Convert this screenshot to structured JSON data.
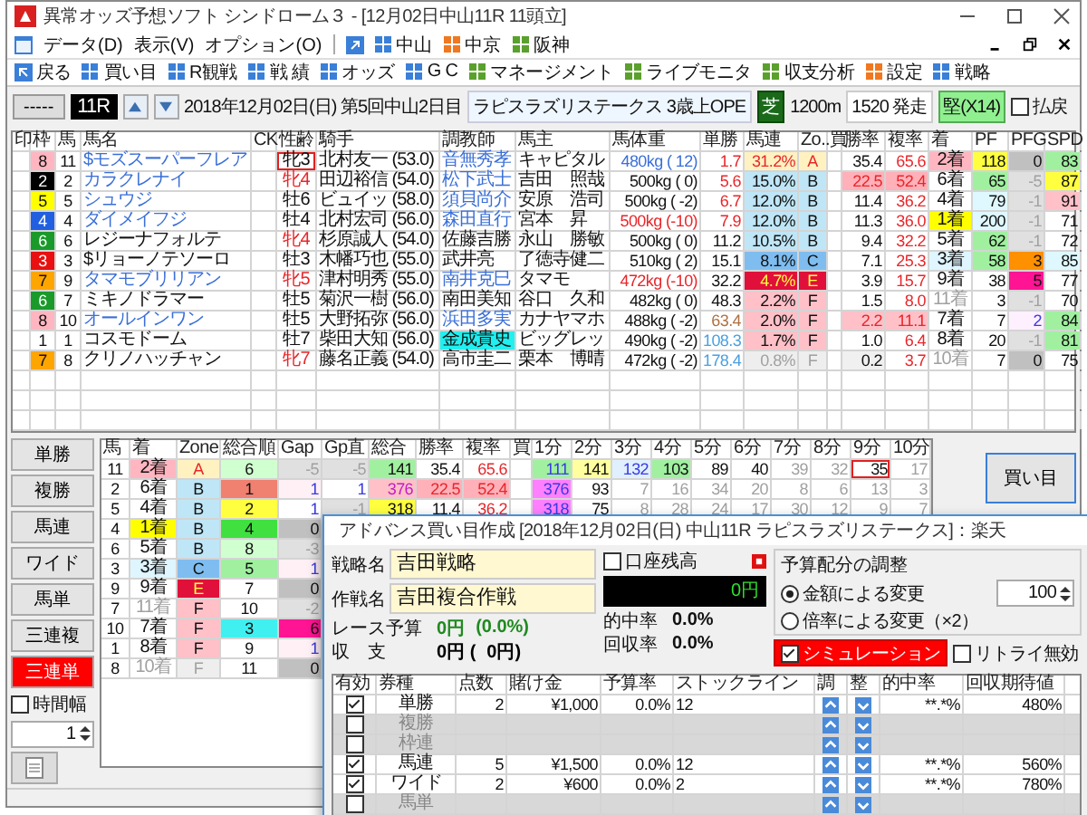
{
  "window": {
    "title": "異常オッズ予想ソフト シンドローム３ - [12月02日中山11R 11頭立]"
  },
  "menu": [
    {
      "label": "データ(D)"
    },
    {
      "label": "表示(V)"
    },
    {
      "label": "オプション(O)"
    }
  ],
  "venues": [
    {
      "label": "中山",
      "color": "#3a7fd8"
    },
    {
      "label": "中京",
      "color": "#f07820"
    },
    {
      "label": "阪神",
      "color": "#5aa02c"
    }
  ],
  "toolbar": [
    {
      "label": "戻る",
      "kind": "back",
      "color": "#3a7fd8"
    },
    {
      "label": "買い目",
      "kind": "grid",
      "color": "#3a7fd8"
    },
    {
      "label": "R観戦",
      "kind": "grid",
      "color": "#3a7fd8"
    },
    {
      "label": "戦 績",
      "kind": "grid",
      "color": "#3a7fd8"
    },
    {
      "label": "オッズ",
      "kind": "grid",
      "color": "#3a7fd8"
    },
    {
      "label": "G C",
      "kind": "grid",
      "color": "#3a7fd8"
    },
    {
      "label": "マネージメント",
      "kind": "grid",
      "color": "#5aa02c"
    },
    {
      "label": "ライブモニタ",
      "kind": "grid",
      "color": "#5aa02c"
    },
    {
      "label": "収支分析",
      "kind": "grid",
      "color": "#5aa02c"
    },
    {
      "label": "設定",
      "kind": "grid",
      "color": "#f07820"
    },
    {
      "label": "戦略",
      "kind": "grid",
      "color": "#3a7fd8"
    }
  ],
  "race": {
    "nav_button": "-----",
    "number": "11R",
    "date": "2018年12月02日(日) 第5回中山2日目",
    "name": "ラピスラズリステークス",
    "class": "3歳上OPE",
    "surface": "芝",
    "distance": "1200m",
    "start": "1520 発走",
    "rating": "堅(X14)",
    "payout": {
      "label": "払戻",
      "checked": false
    }
  },
  "main_table": {
    "columns": [
      "印",
      "枠",
      "馬",
      "馬名",
      "CK",
      "性齢",
      "騎手",
      "調教師",
      "馬主",
      "馬体重",
      "単勝",
      "馬連",
      "Zo..",
      "買",
      "勝率",
      "複率",
      "着",
      "PF",
      "PFG",
      "SPD"
    ],
    "rows": [
      {
        "cells": [
          null,
          {
            "text": "8",
            "color": "#ffb6c1"
          },
          "11",
          {
            "text": "$モズスーパーフレア",
            "kind": "link"
          },
          null,
          {
            "text": "牝3",
            "kind": "framed"
          },
          "北村友一 (53.0)",
          {
            "text": "音無秀孝",
            "kind": "link"
          },
          "キャピタル",
          {
            "text": "480kg ( 12)",
            "kind": "link"
          },
          {
            "text": "1.7",
            "kind": "red"
          },
          {
            "text": "31.2%",
            "color": "#fff2c0",
            "kind": "red"
          },
          {
            "text": "A",
            "color": "#fff2c0",
            "kind": "red"
          },
          null,
          "35.4",
          {
            "text": "65.6",
            "kind": "red"
          },
          {
            "text": "2着",
            "color": "#ffb6c1"
          },
          {
            "text": "118",
            "color": "#ffff40"
          },
          {
            "text": "0",
            "color": "#c0c0c0"
          },
          {
            "text": "83",
            "color": "#a0f0a0"
          }
        ]
      },
      {
        "cells": [
          null,
          {
            "text": "2",
            "color": "#000000",
            "kind": "inverse"
          },
          "2",
          {
            "text": "カラクレナイ",
            "kind": "link"
          },
          null,
          {
            "text": "牝4",
            "kind": "red"
          },
          "田辺裕信 (54.0)",
          {
            "text": "松下武士",
            "kind": "link"
          },
          "吉田　照哉",
          "500kg (  0)",
          {
            "text": "5.6",
            "kind": "red"
          },
          {
            "text": "15.0%",
            "color": "#bfe6f7"
          },
          {
            "text": "B",
            "color": "#bfe6f7"
          },
          null,
          {
            "text": "22.5",
            "color": "#ffb0b8",
            "kind": "red"
          },
          {
            "text": "52.4",
            "color": "#ffb0b8",
            "kind": "red"
          },
          "6着",
          {
            "text": "65",
            "color": "#a0f0a0"
          },
          {
            "text": "-5",
            "color": "#e0e0e0",
            "kind": "muted"
          },
          {
            "text": "87",
            "color": "#ffff40"
          }
        ]
      },
      {
        "cells": [
          null,
          {
            "text": "5",
            "color": "#ffff00"
          },
          "5",
          {
            "text": "シュウジ",
            "kind": "link"
          },
          null,
          "牡6",
          "ビュイッ (58.0)",
          {
            "text": "須貝尚介",
            "kind": "link"
          },
          "安原　浩司",
          "500kg ( -2)",
          {
            "text": "6.7",
            "kind": "red"
          },
          {
            "text": "12.0%",
            "color": "#bfe6f7"
          },
          {
            "text": "B",
            "color": "#bfe6f7"
          },
          null,
          "11.4",
          {
            "text": "36.2",
            "kind": "red"
          },
          "4着",
          {
            "text": "79",
            "color": "#dff8ff"
          },
          {
            "text": "-1",
            "color": "#e0e0e0",
            "kind": "muted"
          },
          {
            "text": "91",
            "color": "#ffc0c8"
          }
        ]
      },
      {
        "cells": [
          null,
          {
            "text": "4",
            "color": "#2060e0",
            "kind": "inverse"
          },
          "4",
          {
            "text": "ダイメイフジ",
            "kind": "link"
          },
          null,
          "牡4",
          "北村宏司 (56.0)",
          {
            "text": "森田直行",
            "kind": "link"
          },
          "宮本　昇",
          {
            "text": "500kg (-10)",
            "kind": "red"
          },
          {
            "text": "7.9",
            "kind": "red"
          },
          {
            "text": "12.0%",
            "color": "#bfe6f7"
          },
          {
            "text": "B",
            "color": "#bfe6f7"
          },
          null,
          "11.3",
          {
            "text": "36.0",
            "kind": "red"
          },
          {
            "text": "1着",
            "color": "#ffff00"
          },
          {
            "text": "200",
            "color": "#dff8ff"
          },
          {
            "text": "-1",
            "color": "#e0e0e0",
            "kind": "muted"
          },
          "71"
        ]
      },
      {
        "cells": [
          null,
          {
            "text": "6",
            "color": "#1a9a2a",
            "kind": "inverse"
          },
          "6",
          "レジーナフォルテ",
          null,
          {
            "text": "牝4",
            "kind": "red"
          },
          "杉原誠人 (54.0)",
          "佐藤吉勝",
          "永山　勝敏",
          "500kg (  0)",
          "11.2",
          {
            "text": "10.5%",
            "color": "#bfe6f7"
          },
          {
            "text": "B",
            "color": "#bfe6f7"
          },
          null,
          "9.4",
          {
            "text": "32.2",
            "kind": "red"
          },
          "5着",
          {
            "text": "62",
            "color": "#a0f0a0"
          },
          {
            "text": "-1",
            "color": "#e0e0e0",
            "kind": "muted"
          },
          "72"
        ]
      },
      {
        "cells": [
          null,
          {
            "text": "3",
            "color": "#e81010",
            "kind": "inverse"
          },
          "3",
          "$リョーノテソーロ",
          null,
          "牡3",
          "木幡巧也 (55.0)",
          "武井亮",
          "了徳寺健二",
          "510kg (  2)",
          "15.1",
          {
            "text": "8.1%",
            "color": "#7fbdf0"
          },
          {
            "text": "C",
            "color": "#7fbdf0"
          },
          null,
          "7.1",
          {
            "text": "25.3",
            "kind": "red"
          },
          {
            "text": "3着",
            "color": "#dff5ff"
          },
          {
            "text": "58",
            "color": "#a0f0a0"
          },
          {
            "text": "3",
            "color": "#ff9000"
          },
          {
            "text": "85",
            "color": "#dff8ff"
          }
        ]
      },
      {
        "cells": [
          null,
          {
            "text": "7",
            "color": "#ffa500"
          },
          "9",
          {
            "text": "タマモブリリアン",
            "kind": "link"
          },
          null,
          {
            "text": "牝5",
            "kind": "red"
          },
          "津村明秀 (55.0)",
          {
            "text": "南井克巳",
            "kind": "link"
          },
          "タマモ",
          {
            "text": "472kg (-10)",
            "kind": "red"
          },
          "32.2",
          {
            "text": "4.7%",
            "color": "#e0103a",
            "kind": "alert"
          },
          {
            "text": "E",
            "color": "#e0103a",
            "kind": "alert"
          },
          null,
          "3.9",
          {
            "text": "15.7",
            "kind": "red"
          },
          "9着",
          "38",
          {
            "text": "5",
            "color": "#ff1493"
          },
          "77"
        ]
      },
      {
        "cells": [
          null,
          {
            "text": "6",
            "color": "#1a9a2a",
            "kind": "inverse"
          },
          "7",
          "ミキノドラマー",
          null,
          "牡5",
          "菊沢一樹 (56.0)",
          "南田美知",
          "谷口　久和",
          "482kg (  0)",
          "48.3",
          {
            "text": "2.2%",
            "color": "#ffc0c8"
          },
          {
            "text": "F",
            "color": "#ffc0c8"
          },
          null,
          "1.5",
          {
            "text": "8.0",
            "kind": "red"
          },
          {
            "text": "11着",
            "kind": "muted"
          },
          "3",
          {
            "text": "-1",
            "color": "#e0e0e0",
            "kind": "muted"
          },
          "70"
        ]
      },
      {
        "cells": [
          null,
          {
            "text": "8",
            "color": "#ffb6c1"
          },
          "10",
          {
            "text": "オールインワン",
            "kind": "link"
          },
          null,
          "牡5",
          "大野拓弥 (56.0)",
          {
            "text": "浜田多実",
            "kind": "link"
          },
          "カナヤマホ",
          "488kg ( -2)",
          {
            "text": "63.4",
            "kind": "brown"
          },
          {
            "text": "2.0%",
            "color": "#ffc0c8"
          },
          {
            "text": "F",
            "color": "#ffc0c8"
          },
          null,
          {
            "text": "2.2",
            "color": "#ffc0c8",
            "kind": "red"
          },
          {
            "text": "11.1",
            "color": "#ffc0c8",
            "kind": "red"
          },
          "7着",
          "7",
          {
            "text": "2",
            "color": "#fff0ff",
            "kind": "violet"
          },
          {
            "text": "84",
            "color": "#a0f0a0"
          }
        ]
      },
      {
        "cells": [
          null,
          "1",
          "1",
          "コスモドーム",
          null,
          "牡7",
          "柴田大知 (56.0)",
          {
            "text": "金成貴史",
            "color": "#20f0f0"
          },
          "ビッグレッ",
          "490kg ( -2)",
          {
            "text": "108.3",
            "kind": "sky"
          },
          {
            "text": "1.7%",
            "color": "#ffc0c8"
          },
          {
            "text": "F",
            "color": "#ffc0c8"
          },
          null,
          "1.0",
          {
            "text": "6.4",
            "kind": "red"
          },
          "8着",
          "20",
          {
            "text": "-1",
            "color": "#e0e0e0",
            "kind": "muted"
          },
          {
            "text": "81",
            "color": "#a0f0a0"
          }
        ]
      },
      {
        "cells": [
          null,
          {
            "text": "7",
            "color": "#ffa500"
          },
          "8",
          "クリノハッチャン",
          null,
          {
            "text": "牝7",
            "kind": "red"
          },
          "藤名正義 (54.0)",
          "高市圭二",
          "栗本　博晴",
          "472kg ( -2)",
          {
            "text": "178.4",
            "kind": "sky"
          },
          {
            "text": "0.8%",
            "color": "#eeeeee",
            "kind": "muted"
          },
          {
            "text": "F",
            "color": "#eeeeee",
            "kind": "muted"
          },
          null,
          {
            "text": "0.2",
            "color": "#f0f0f0"
          },
          {
            "text": "3.7",
            "kind": "red"
          },
          {
            "text": "10着",
            "kind": "muted"
          },
          "7",
          {
            "text": "0",
            "color": "#c0c0c0"
          },
          "75"
        ]
      }
    ]
  },
  "bet_types": [
    {
      "label": "単勝",
      "selected": false
    },
    {
      "label": "複勝",
      "selected": false
    },
    {
      "label": "馬連",
      "selected": false
    },
    {
      "label": "ワイド",
      "selected": false
    },
    {
      "label": "馬単",
      "selected": false
    },
    {
      "label": "三連複",
      "selected": false
    },
    {
      "label": "三連単",
      "selected": true
    }
  ],
  "time_range": {
    "label": "時間幅",
    "checked": false
  },
  "spinner": {
    "value": "1"
  },
  "sub_table": {
    "columns": [
      "馬",
      "着",
      "Zone",
      "総合順",
      "Gap",
      "Gp直",
      "総合",
      "勝率",
      "複率",
      "買",
      "1分",
      "2分",
      "3分",
      "4分",
      "5分",
      "6分",
      "7分",
      "8分",
      "9分",
      "10分"
    ],
    "rows": [
      {
        "cells": [
          "11",
          {
            "text": "2着",
            "color": "#ffb6c1"
          },
          {
            "text": "A",
            "color": "#fff2c0",
            "kind": "red"
          },
          {
            "text": "6",
            "color": "#d0ffd0"
          },
          {
            "text": "-5",
            "color": "#e0e0e0",
            "kind": "muted"
          },
          {
            "text": "-5",
            "color": "#e0e0e0",
            "kind": "muted"
          },
          {
            "text": "141",
            "color": "#a0f0a0"
          },
          "35.4",
          {
            "text": "65.6",
            "kind": "red"
          },
          null,
          {
            "text": "111",
            "color": "#a0f0a0",
            "kind": "violet"
          },
          {
            "text": "141",
            "color": "#ffffa0"
          },
          {
            "text": "132",
            "color": "#e0f0ff",
            "kind": "violet"
          },
          {
            "text": "103",
            "color": "#a0f0a0"
          },
          "89",
          "40",
          {
            "text": "39",
            "kind": "muted"
          },
          {
            "text": "32",
            "kind": "muted"
          },
          {
            "text": "35",
            "kind": "framed"
          },
          {
            "text": "17",
            "kind": "muted"
          }
        ]
      },
      {
        "cells": [
          "2",
          "6着",
          {
            "text": "B",
            "color": "#bfe6f7"
          },
          {
            "text": "1",
            "color": "#f08070"
          },
          {
            "text": "1",
            "color": "#fff0f5",
            "kind": "violet"
          },
          {
            "text": "1",
            "kind": "violet"
          },
          {
            "text": "376",
            "color": "#ffc0c8",
            "kind": "magenta"
          },
          {
            "text": "22.5",
            "color": "#ffb0b8",
            "kind": "red"
          },
          {
            "text": "52.4",
            "color": "#ffb0b8",
            "kind": "red"
          },
          null,
          {
            "text": "376",
            "color": "#ff80ff",
            "kind": "violet"
          },
          "93",
          {
            "text": "7",
            "kind": "muted"
          },
          {
            "text": "16",
            "kind": "muted"
          },
          {
            "text": "34",
            "kind": "muted"
          },
          {
            "text": "20",
            "kind": "muted"
          },
          {
            "text": "8",
            "kind": "muted"
          },
          {
            "text": "6",
            "kind": "muted"
          },
          {
            "text": "13",
            "kind": "muted"
          },
          {
            "text": "3",
            "kind": "muted"
          }
        ]
      },
      {
        "cells": [
          "5",
          "4着",
          {
            "text": "B",
            "color": "#bfe6f7"
          },
          {
            "text": "2",
            "color": "#ffff40"
          },
          {
            "text": "1",
            "kind": "violet"
          },
          {
            "text": "-1",
            "color": "#e0e0e0",
            "kind": "muted"
          },
          {
            "text": "318",
            "color": "#ffff40"
          },
          "11.4",
          {
            "text": "36.2",
            "kind": "red"
          },
          null,
          {
            "text": "318",
            "color": "#ff80ff",
            "kind": "violet"
          },
          "75",
          {
            "text": "8",
            "kind": "muted"
          },
          {
            "text": "28",
            "kind": "muted"
          },
          {
            "text": "24",
            "kind": "muted"
          },
          {
            "text": "17",
            "kind": "muted"
          },
          {
            "text": "30",
            "kind": "muted"
          },
          {
            "text": "12",
            "kind": "muted"
          },
          {
            "text": "9",
            "kind": "muted"
          },
          {
            "text": "7",
            "kind": "muted"
          }
        ]
      },
      {
        "cells": [
          "4",
          {
            "text": "1着",
            "color": "#ffff00"
          },
          {
            "text": "B",
            "color": "#bfe6f7"
          },
          {
            "text": "4",
            "color": "#40e040"
          },
          {
            "text": "0",
            "color": "#c0c0c0"
          }
        ]
      },
      {
        "cells": [
          "6",
          "5着",
          {
            "text": "B",
            "color": "#bfe6f7"
          },
          {
            "text": "8",
            "color": "#d0ffd0"
          },
          {
            "text": "-3",
            "color": "#e0e0e0",
            "kind": "muted"
          }
        ]
      },
      {
        "cells": [
          "3",
          {
            "text": "3着",
            "color": "#dff5ff"
          },
          {
            "text": "C",
            "color": "#7fbdf0"
          },
          {
            "text": "5",
            "color": "#a0f0a0"
          },
          {
            "text": "1",
            "color": "#fff0f5",
            "kind": "violet"
          }
        ]
      },
      {
        "cells": [
          "9",
          "9着",
          {
            "text": "E",
            "color": "#e0103a",
            "kind": "alert"
          },
          "7",
          {
            "text": "0",
            "color": "#c0c0c0"
          }
        ]
      },
      {
        "cells": [
          "7",
          {
            "text": "11着",
            "kind": "muted"
          },
          {
            "text": "F",
            "color": "#ffc0c8"
          },
          "10",
          {
            "text": "-2",
            "color": "#e0e0e0",
            "kind": "muted"
          }
        ]
      },
      {
        "cells": [
          "10",
          "7着",
          {
            "text": "F",
            "color": "#ffc0c8"
          },
          {
            "text": "3",
            "color": "#40f0f0"
          },
          {
            "text": "6",
            "color": "#ff1493"
          }
        ]
      },
      {
        "cells": [
          "1",
          "8着",
          {
            "text": "F",
            "color": "#ffc0c8"
          },
          "9",
          {
            "text": "1",
            "color": "#fff0f5",
            "kind": "violet"
          }
        ]
      },
      {
        "cells": [
          "8",
          {
            "text": "10着",
            "kind": "muted"
          },
          {
            "text": "F",
            "color": "#eeeeee",
            "kind": "muted"
          },
          "11",
          {
            "text": "0",
            "color": "#c0c0c0"
          }
        ]
      }
    ]
  },
  "buy_button": "買い目",
  "dialog": {
    "title": "アドバンス買い目作成 [2018年12月02日(日) 中山11R ラピスラズリステークス]：楽天",
    "strategy": {
      "label": "戦略名",
      "value": "吉田戦略"
    },
    "plan": {
      "label": "作戦名",
      "value": "吉田複合作戦"
    },
    "balance": {
      "label": "口座残高",
      "checked": false,
      "value": "0円"
    },
    "stats": [
      {
        "label": "レース予算",
        "value": "0円",
        "extra": "(0.0%)",
        "color": "#208a20"
      },
      {
        "label": "収　支",
        "value": "0円 (",
        "extra": "0円)",
        "color": "#000000"
      }
    ],
    "rates": [
      {
        "label": "的中率",
        "value": "0.0%"
      },
      {
        "label": "回収率",
        "value": "0.0%"
      }
    ],
    "adjust": {
      "title": "予算配分の調整",
      "options": [
        {
          "label": "金額による変更",
          "selected": true
        },
        {
          "label": "倍率による変更（×2）",
          "selected": false
        }
      ],
      "amount": "100"
    },
    "simulation": {
      "label": "シミュレーション",
      "checked": true
    },
    "retry": {
      "label": "リトライ無効",
      "checked": false
    },
    "table": {
      "columns": [
        "有効",
        "券種",
        "点数",
        "賭け金",
        "予算率",
        "ストックライン",
        "調",
        "整",
        "的中率",
        "回収期待値"
      ],
      "rows": [
        {
          "checked": true,
          "type": "単勝",
          "points": "2",
          "stake": "¥1,000",
          "budget": "0.0%",
          "stock": "12",
          "hit": "**.*%",
          "return": "480%"
        },
        {
          "checked": false,
          "type": "複勝"
        },
        {
          "checked": false,
          "type": "枠連"
        },
        {
          "checked": true,
          "type": "馬連",
          "points": "5",
          "stake": "¥1,500",
          "budget": "0.0%",
          "stock": "12",
          "hit": "**.*%",
          "return": "560%"
        },
        {
          "checked": true,
          "type": "ワイド",
          "points": "2",
          "stake": "¥600",
          "budget": "0.0%",
          "stock": "2",
          "hit": "**.*%",
          "return": "780%"
        },
        {
          "checked": false,
          "type": "馬単"
        }
      ]
    }
  }
}
